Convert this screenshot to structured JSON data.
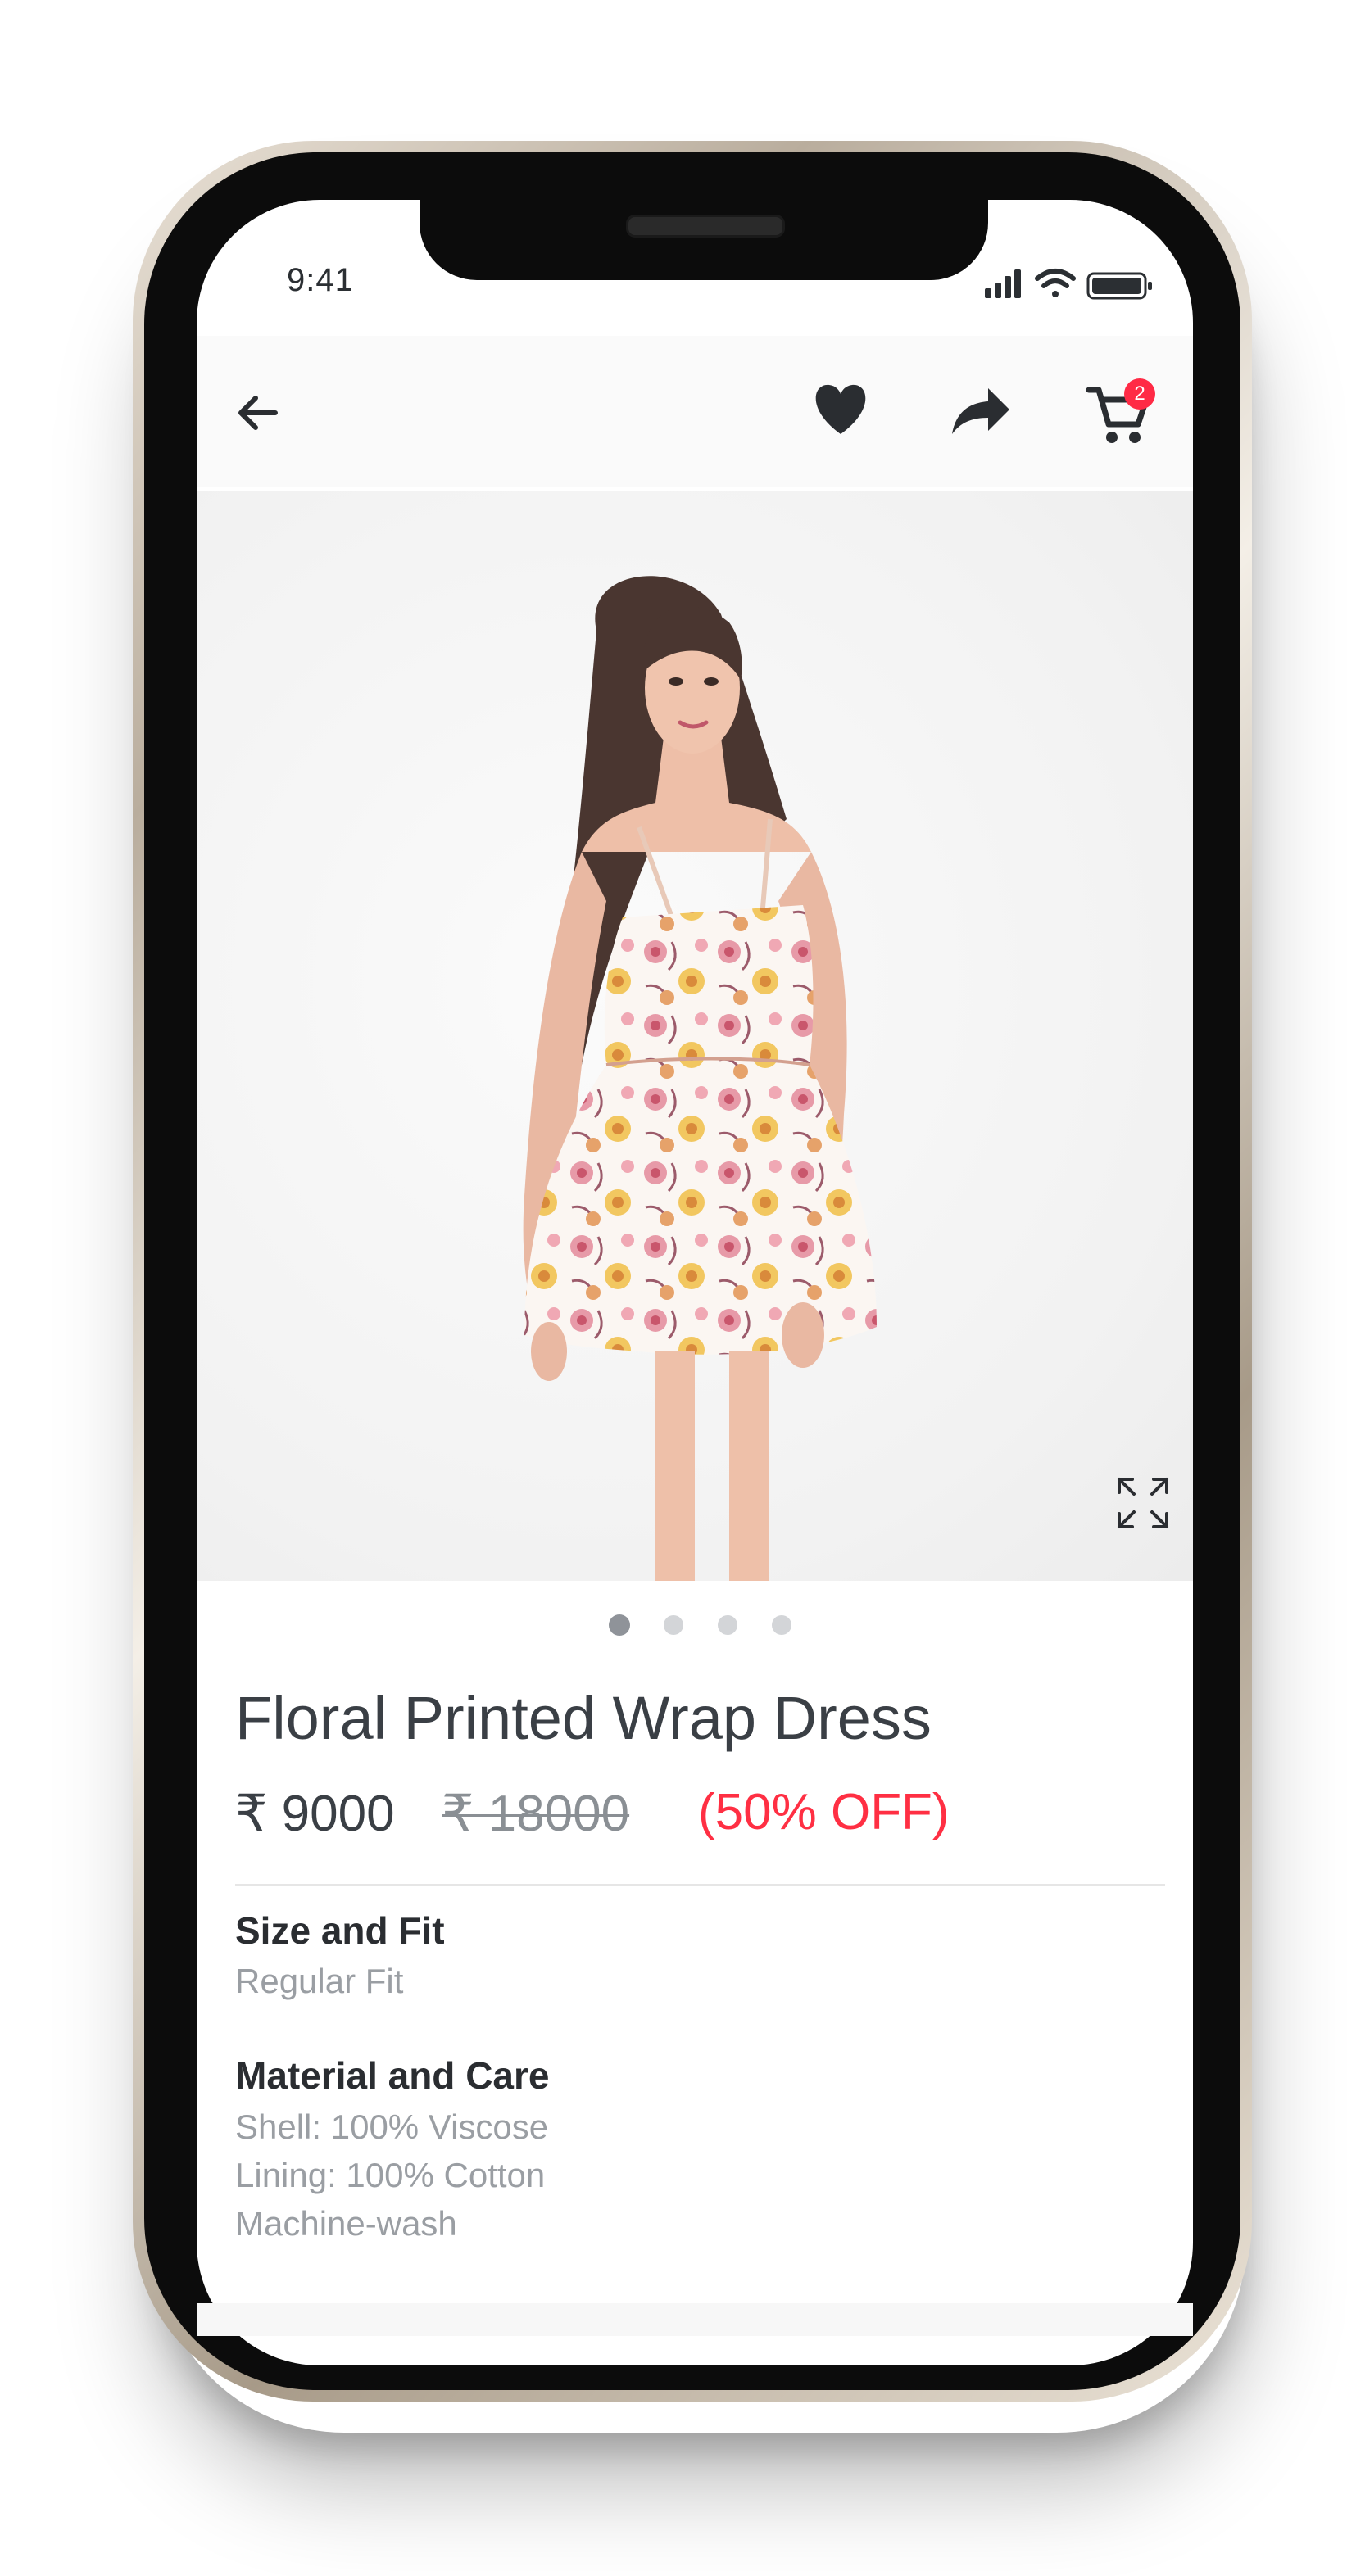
{
  "status_bar": {
    "time": "9:41"
  },
  "toolbar": {
    "back_icon": "arrow-left-icon",
    "wishlist_icon": "heart-icon",
    "share_icon": "share-icon",
    "cart_icon": "cart-icon",
    "cart_count": "2",
    "badge_color": "#ff2a45"
  },
  "gallery": {
    "image_description": "product-photo",
    "expand_icon": "expand-icon",
    "total_images": 4,
    "active_index": 0
  },
  "product": {
    "title": "Floral Printed Wrap Dress",
    "price": "₹ 9000",
    "mrp": "₹ 18000",
    "discount": "(50% OFF)",
    "discount_color": "#ff2f43"
  },
  "details": {
    "size_fit": {
      "heading": "Size and Fit",
      "value": "Regular Fit"
    },
    "material_care": {
      "heading": "Material and Care",
      "lines": [
        "Shell: 100% Viscose",
        "Lining: 100% Cotton",
        "Machine-wash"
      ]
    }
  }
}
